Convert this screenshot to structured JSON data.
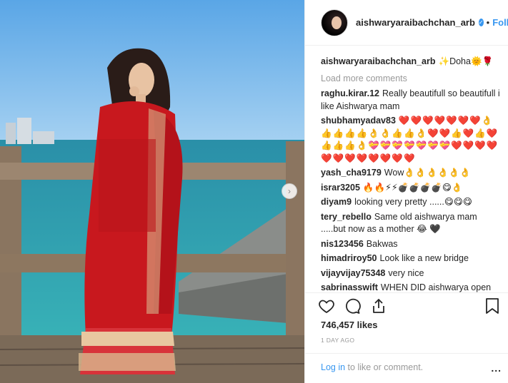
{
  "post": {
    "username": "aishwaryaraibachchan_arb",
    "verified_icon": "verified-badge-icon",
    "follow_label": "Follow",
    "caption_text": "✨Doha🌞🌹",
    "load_more": "Load more comments",
    "comments": [
      {
        "user": "raghu.kirar.12",
        "text": "Really beautifull so beautifull i like Aishwarya mam"
      },
      {
        "user": "shubhamyadav83",
        "text": "❤️❤️❤️❤️❤️❤️❤️👌👍👍👍👍👌👌👍👍👌❤️❤️👍❤️👍❤️👍👍👍👌💝💝💝💝💝💝💝❤️❤️❤️❤️❤️❤️❤️❤️❤️❤️❤️❤️"
      },
      {
        "user": "yash_cha9179",
        "text": "Wow👌👌👌👌👌👌"
      },
      {
        "user": "israr3205",
        "text": "🔥🔥⚡⚡💣💣💣💣😋👌"
      },
      {
        "user": "diyam9",
        "text": "looking very pretty ......😋😋😋"
      },
      {
        "user": "tery_rebello",
        "text": "Same old aishwarya mam .....but now as a mother 😂 🖤"
      },
      {
        "user": "nis123456",
        "text": "Bakwas"
      },
      {
        "user": "himadriroy50",
        "text": "Look like a new bridge"
      },
      {
        "user": "vijayvijay75348",
        "text": "very nice"
      },
      {
        "user": "sabrinasswift",
        "text": "WHEN DID aishwarya open"
      }
    ],
    "likes": "746,457 likes",
    "time_ago": "1 DAY AGO",
    "footer": {
      "login": "Log in",
      "rest": "to like or comment.",
      "more": "..."
    },
    "carousel_icon": "chevron-right-icon"
  }
}
